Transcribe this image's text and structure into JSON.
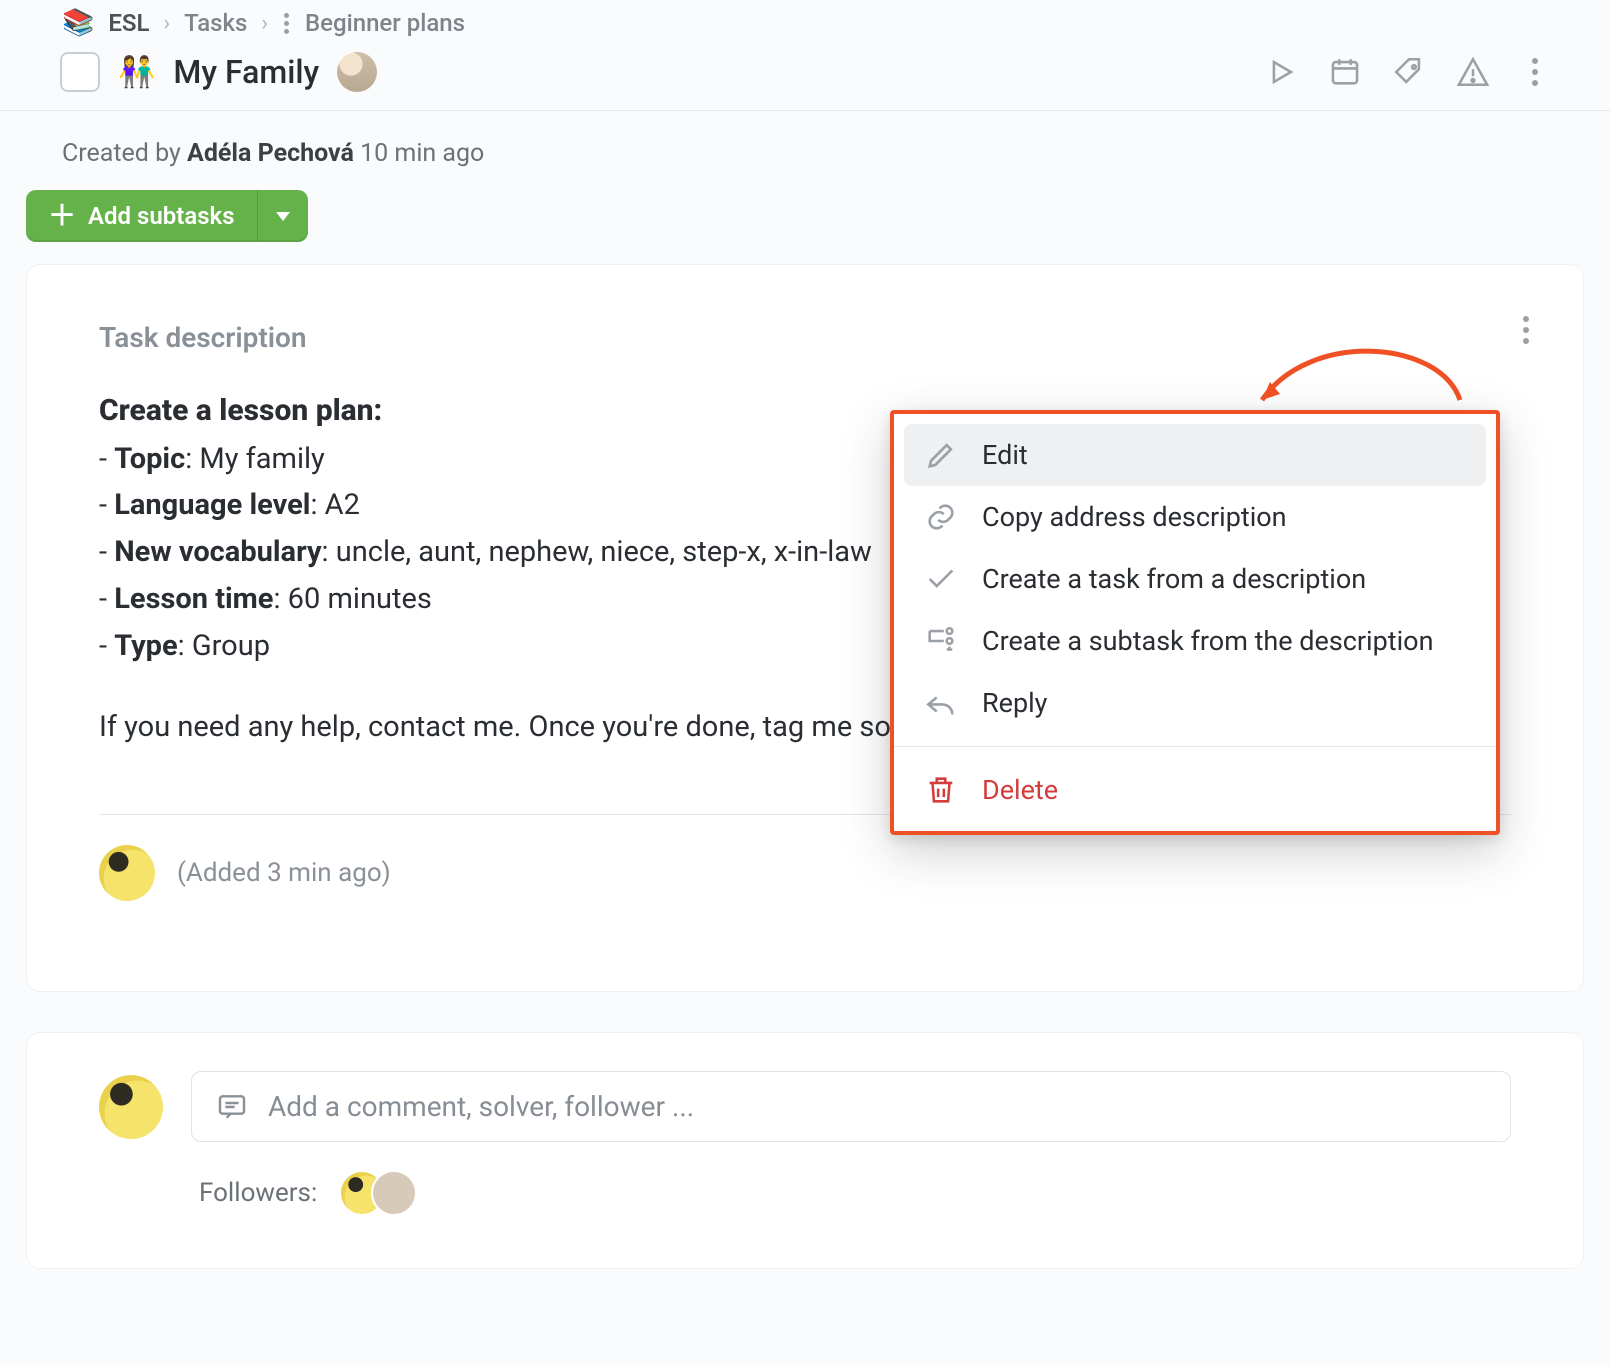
{
  "breadcrumb": {
    "icon": "📚",
    "project": "ESL",
    "section": "Tasks",
    "current": "Beginner plans"
  },
  "task": {
    "emoji": "👫",
    "title": "My Family",
    "created_by_prefix": "Created by ",
    "created_by": "Adéla Pechová",
    "created_when": "10 min ago"
  },
  "subtasks_btn": {
    "label": "Add subtasks"
  },
  "description": {
    "heading": "Task description",
    "lead": "Create a lesson plan:",
    "items": [
      {
        "k": "Topic",
        "v": ": My family"
      },
      {
        "k": "Language level",
        "v": ": A2"
      },
      {
        "k": "New vocabulary",
        "v": ": uncle, aunt, nephew, niece, step-x, x-in-law"
      },
      {
        "k": "Lesson time",
        "v": ": 60 minutes"
      },
      {
        "k": "Type",
        "v": ": Group"
      }
    ],
    "para": "If you need any help, contact me. Once you're done, tag me so I can check it. Cheers!"
  },
  "added": {
    "text": "(Added 3 min ago)"
  },
  "ctx": {
    "edit": "Edit",
    "copy": "Copy address description",
    "to_task": "Create a task from a description",
    "to_subtask": "Create a subtask from the description",
    "reply": "Reply",
    "delete": "Delete"
  },
  "comment": {
    "placeholder": "Add a comment, solver, follower ...",
    "followers_label": "Followers:"
  }
}
